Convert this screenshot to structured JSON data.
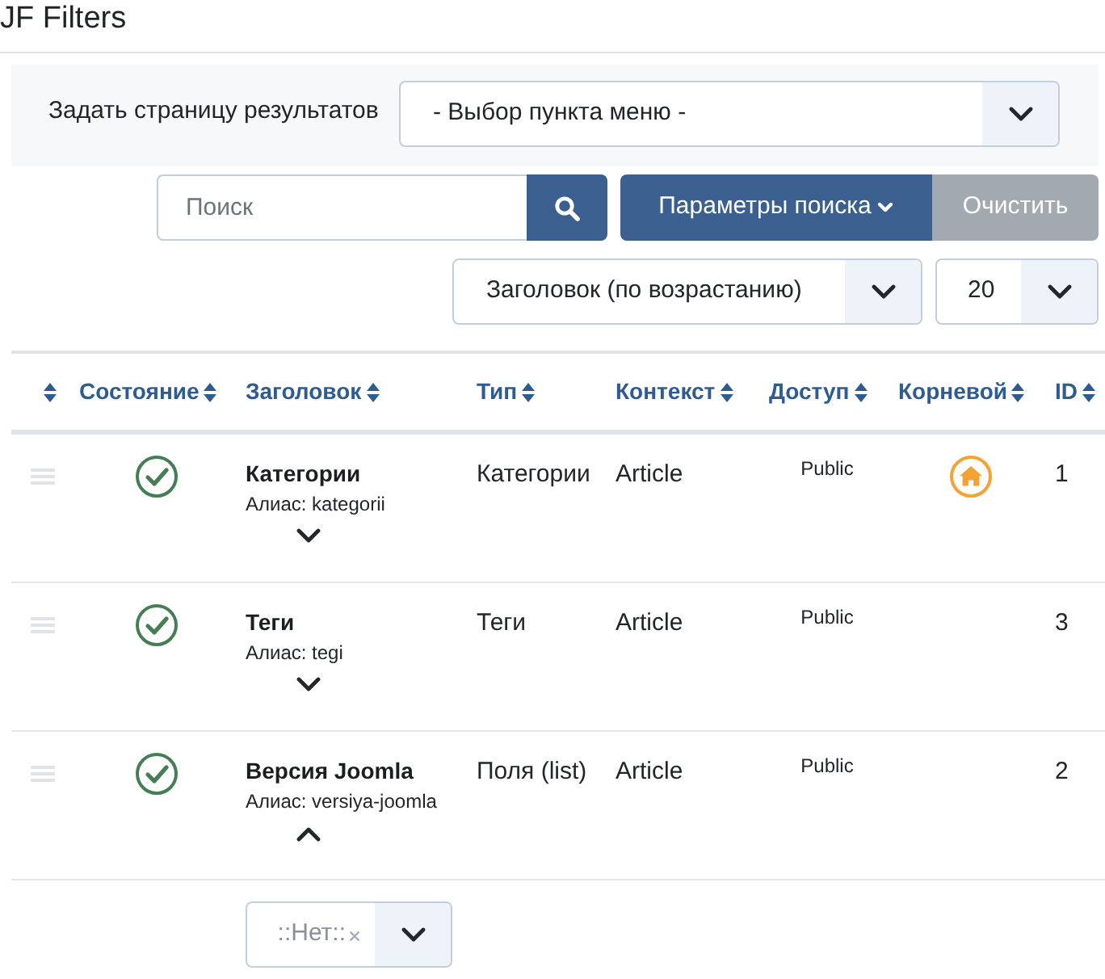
{
  "title": "JF Filters",
  "results_page": {
    "label": "Задать страницу результатов",
    "select": {
      "value": "- Выбор пункта меню -"
    }
  },
  "search": {
    "placeholder": "Поиск"
  },
  "buttons": [
    {
      "label": "Параметры поиска",
      "kind": "options"
    },
    {
      "label": "Очистить",
      "kind": "clear"
    }
  ],
  "sort_select": {
    "value": "Заголовок (по возрастанию)"
  },
  "limit_select": {
    "value": "20"
  },
  "table": {
    "columns": [
      "Состояние",
      "Заголовок",
      "Тип",
      "Контекст",
      "Доступ",
      "Корневой",
      "ID"
    ],
    "rows": [
      {
        "title": "Категории",
        "alias": "Алиас: kategorii",
        "expanded": false,
        "published": true,
        "type": "Категории",
        "context": "Article",
        "access": "Public",
        "root": true,
        "id": "1"
      },
      {
        "title": "Теги",
        "alias": "Алиас: tegi",
        "expanded": false,
        "published": true,
        "type": "Теги",
        "context": "Article",
        "access": "Public",
        "root": false,
        "id": "3"
      },
      {
        "title": "Версия Joomla",
        "alias": "Алиас: versiya-joomla",
        "expanded": true,
        "published": true,
        "type": "Поля (list)",
        "context": "Article",
        "access": "Public",
        "root": false,
        "id": "2"
      }
    ]
  },
  "filter_select": {
    "value": "::Нет::"
  }
}
